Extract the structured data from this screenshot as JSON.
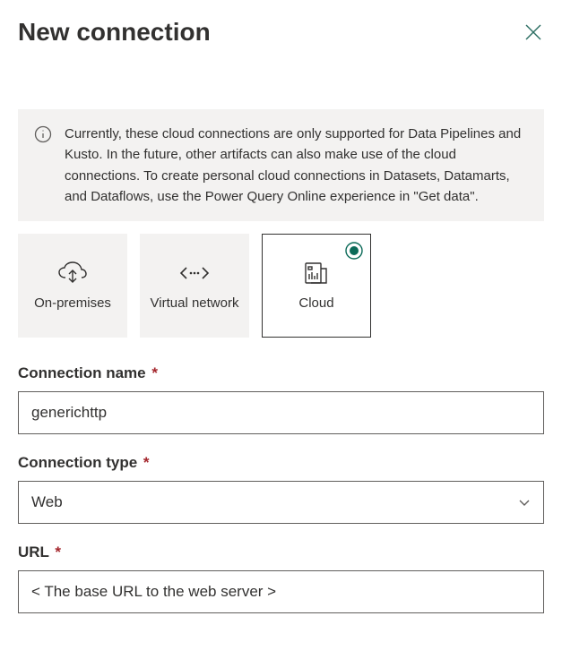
{
  "header": {
    "title": "New connection"
  },
  "info": {
    "text": "Currently, these cloud connections are only supported for Data Pipelines and Kusto. In the future, other artifacts can also make use of the cloud connections. To create personal cloud connections in Datasets, Datamarts, and Dataflows, use the Power Query Online experience in \"Get data\"."
  },
  "tiles": {
    "onpremises": {
      "label": "On-premises"
    },
    "virtual": {
      "label": "Virtual network"
    },
    "cloud": {
      "label": "Cloud"
    }
  },
  "form": {
    "connection_name": {
      "label": "Connection name",
      "value": "generichttp"
    },
    "connection_type": {
      "label": "Connection type",
      "value": "Web"
    },
    "url": {
      "label": "URL",
      "value": "< The base URL to the web server >"
    }
  },
  "required_marker": "*"
}
